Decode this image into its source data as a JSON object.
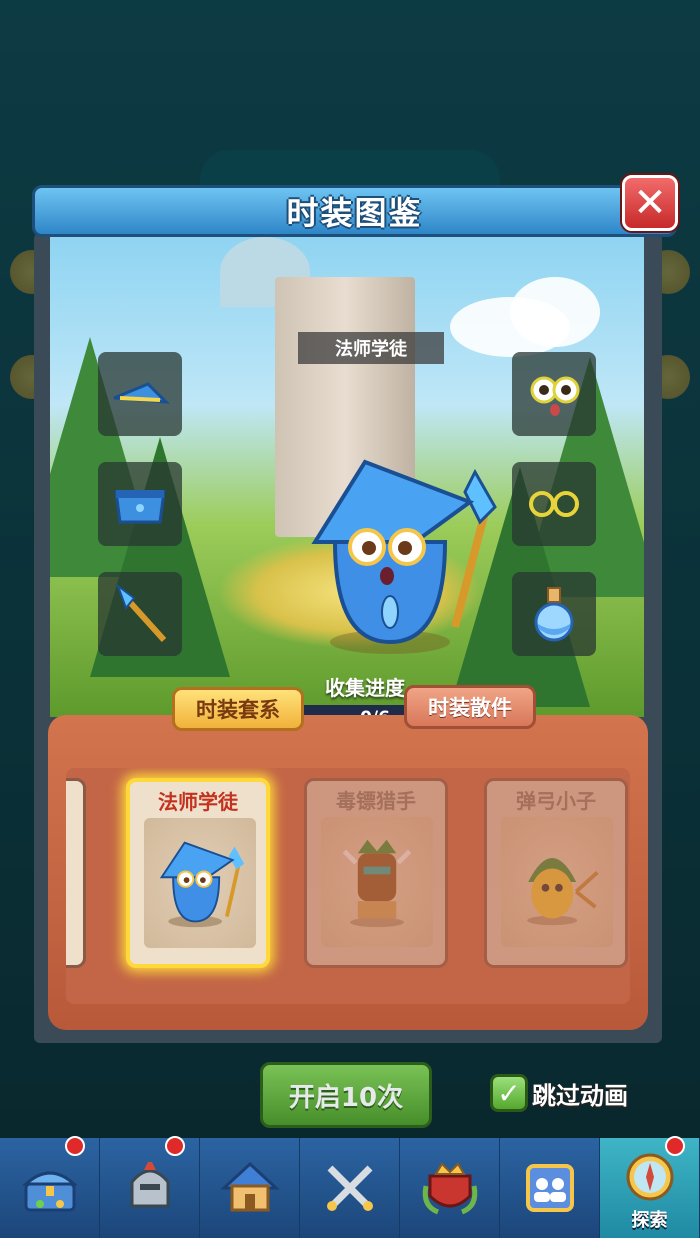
{
  "modal": {
    "title": "时装图鉴",
    "close_icon": "close-icon",
    "character_name": "法师学徒",
    "progress_label": "收集进度",
    "progress_text": "0/6",
    "progress_value": 0,
    "left_slots": [
      "hat-icon",
      "skirt-icon",
      "staff-icon"
    ],
    "right_slots": [
      "eyes-icon",
      "glasses-icon",
      "potion-icon"
    ]
  },
  "tabs": {
    "sets": "时装套系",
    "pieces": "时装散件",
    "active": "sets"
  },
  "cards": [
    {
      "name": "法师学徒",
      "state": "selected",
      "icon": "mage-apprentice-icon"
    },
    {
      "name": "毒镖猎手",
      "state": "locked",
      "icon": "dart-hunter-icon"
    },
    {
      "name": "弹弓小子",
      "state": "locked",
      "icon": "slingshot-kid-icon"
    }
  ],
  "footer": {
    "start_button": "开启10次",
    "skip_label": "跳过动画",
    "skip_checked": true
  },
  "nav": [
    {
      "icon": "treasure-chest-icon",
      "badge": true,
      "label": ""
    },
    {
      "icon": "knight-helmet-icon",
      "badge": true,
      "label": ""
    },
    {
      "icon": "house-icon",
      "badge": false,
      "label": ""
    },
    {
      "icon": "crossed-swords-icon",
      "badge": false,
      "label": ""
    },
    {
      "icon": "crown-shield-icon",
      "badge": false,
      "label": ""
    },
    {
      "icon": "guild-icon",
      "badge": false,
      "label": ""
    },
    {
      "icon": "compass-icon",
      "badge": true,
      "label": "探索",
      "active": true
    }
  ],
  "colors": {
    "accent": "#2f86c8",
    "selected_glow": "#ffd83a",
    "wood": "#c36547"
  }
}
